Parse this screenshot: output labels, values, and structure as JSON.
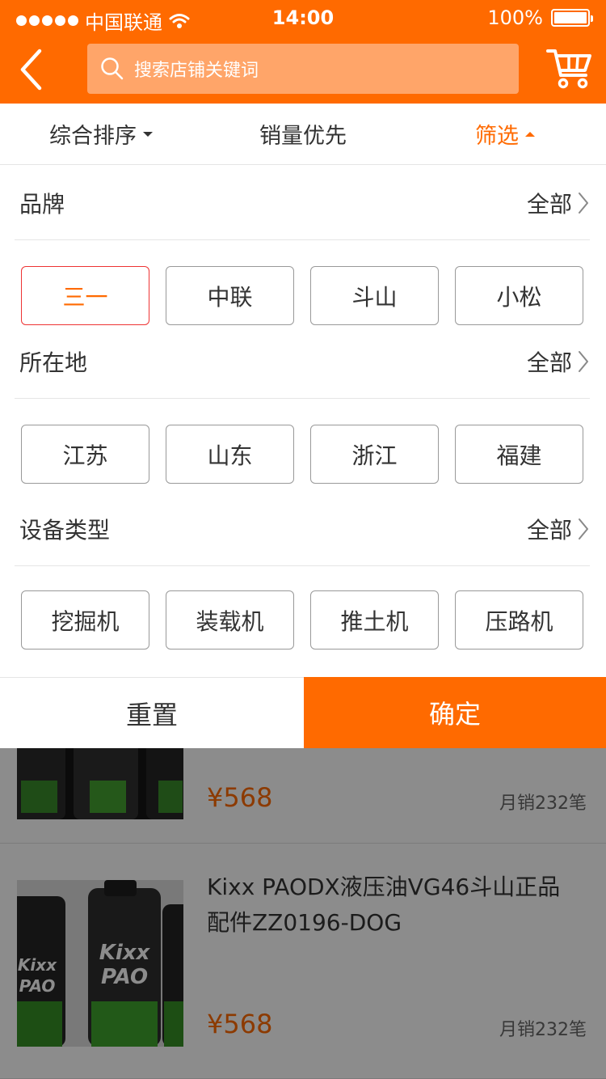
{
  "status": {
    "carrier": "中国联通",
    "time": "14:00",
    "battery": "100%"
  },
  "header": {
    "search_placeholder": "搜索店铺关键词",
    "back_icon": "chevron-left-icon",
    "cart_icon": "cart-icon",
    "accent_color": "#ff6a00"
  },
  "sort": {
    "items": [
      {
        "label": "综合排序"
      },
      {
        "label": "销量优先"
      },
      {
        "label": "筛选"
      }
    ]
  },
  "filter": {
    "sections": [
      {
        "title": "品牌",
        "all_label": "全部",
        "options": [
          "三一",
          "中联",
          "斗山",
          "小松"
        ],
        "selected": "三一"
      },
      {
        "title": "所在地",
        "all_label": "全部",
        "options": [
          "江苏",
          "山东",
          "浙江",
          "福建"
        ]
      },
      {
        "title": "设备类型",
        "all_label": "全部",
        "options": [
          "挖掘机",
          "装载机",
          "推土机",
          "压路机"
        ]
      }
    ]
  },
  "actions": {
    "reset_label": "重置",
    "confirm_label": "确定"
  },
  "products": [
    {
      "title": "",
      "price": "¥568",
      "sales": "月销232笔"
    },
    {
      "title": "Kixx PAODX液压油VG46斗山正品配件ZZ0196-DOG",
      "price": "¥568",
      "sales": "月销232笔"
    }
  ]
}
